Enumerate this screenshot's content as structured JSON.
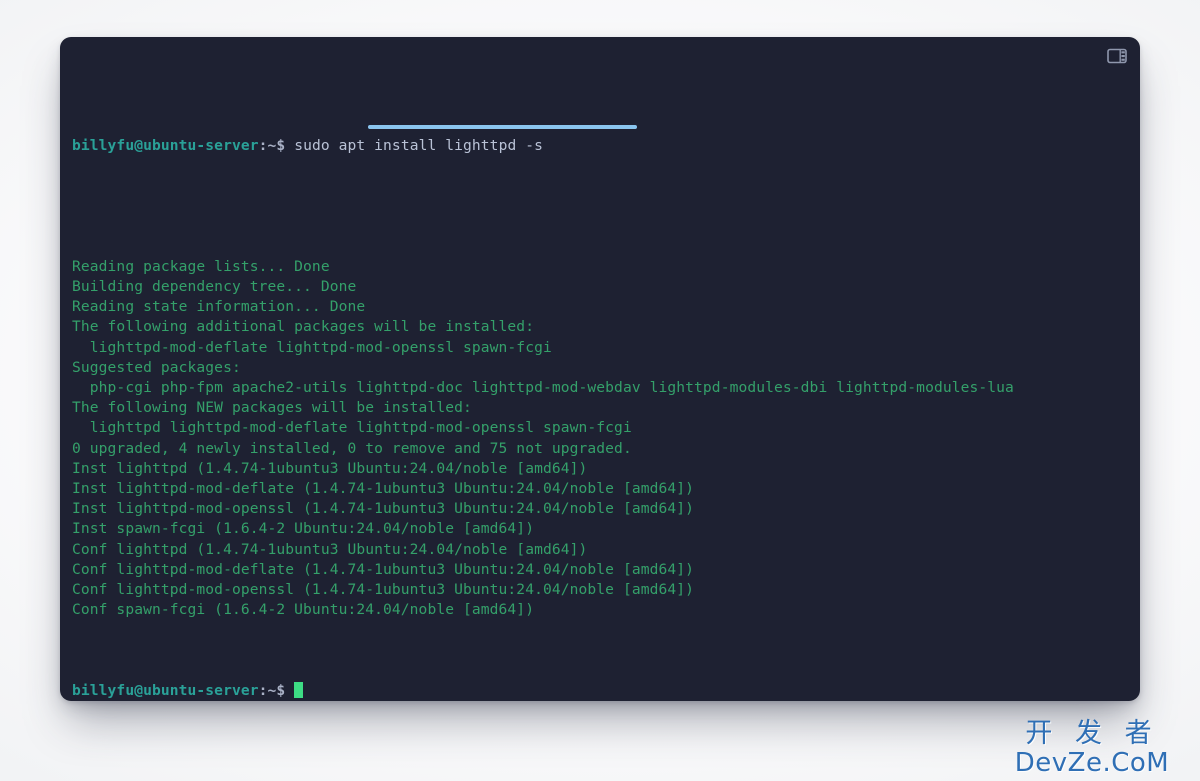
{
  "window": {
    "background_color": "#1e2132",
    "page_background_color": "#ffffff",
    "titlebar": {
      "panel_toggle_icon": "panel-layout-icon"
    }
  },
  "terminal": {
    "colors": {
      "prompt_user": "#2aa198",
      "prompt_punct": "#a9b1c6",
      "command_text": "#b9c2d6",
      "output_text": "#34a06a",
      "cursor": "#3ddc84",
      "underline": "#8ac5ef"
    },
    "prompt": {
      "user_host": "billyfu@ubuntu-server",
      "path_sign": ":~$"
    },
    "command": "sudo apt install lighttpd -s",
    "output_lines": [
      "Reading package lists... Done",
      "Building dependency tree... Done",
      "Reading state information... Done",
      "The following additional packages will be installed:",
      "  lighttpd-mod-deflate lighttpd-mod-openssl spawn-fcgi",
      "Suggested packages:",
      "  php-cgi php-fpm apache2-utils lighttpd-doc lighttpd-mod-webdav lighttpd-modules-dbi lighttpd-modules-lua",
      "The following NEW packages will be installed:",
      "  lighttpd lighttpd-mod-deflate lighttpd-mod-openssl spawn-fcgi",
      "0 upgraded, 4 newly installed, 0 to remove and 75 not upgraded.",
      "Inst lighttpd (1.4.74-1ubuntu3 Ubuntu:24.04/noble [amd64])",
      "Inst lighttpd-mod-deflate (1.4.74-1ubuntu3 Ubuntu:24.04/noble [amd64])",
      "Inst lighttpd-mod-openssl (1.4.74-1ubuntu3 Ubuntu:24.04/noble [amd64])",
      "Inst spawn-fcgi (1.6.4-2 Ubuntu:24.04/noble [amd64])",
      "Conf lighttpd (1.4.74-1ubuntu3 Ubuntu:24.04/noble [amd64])",
      "Conf lighttpd-mod-deflate (1.4.74-1ubuntu3 Ubuntu:24.04/noble [amd64])",
      "Conf lighttpd-mod-openssl (1.4.74-1ubuntu3 Ubuntu:24.04/noble [amd64])",
      "Conf spawn-fcgi (1.6.4-2 Ubuntu:24.04/noble [amd64])"
    ]
  },
  "watermark": {
    "line1": "开 发 者",
    "line2": "DevZe.CoM"
  }
}
